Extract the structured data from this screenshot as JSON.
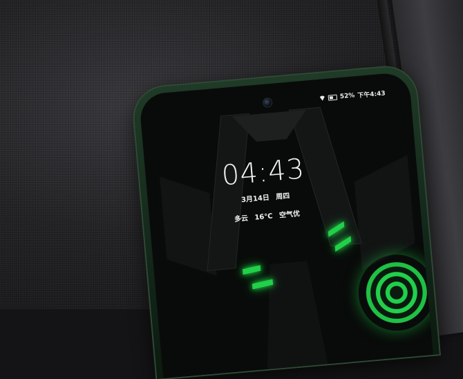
{
  "status_bar": {
    "battery": "52%",
    "time": "下午4:43"
  },
  "lock_screen": {
    "clock": "04:43",
    "date": "3月14日",
    "weekday": "周四",
    "weather": "多云",
    "temperature": "16°C",
    "air_quality": "空气优"
  },
  "colors": {
    "accent_green": "#22d04a",
    "phone_frame": "#1f3a26"
  }
}
